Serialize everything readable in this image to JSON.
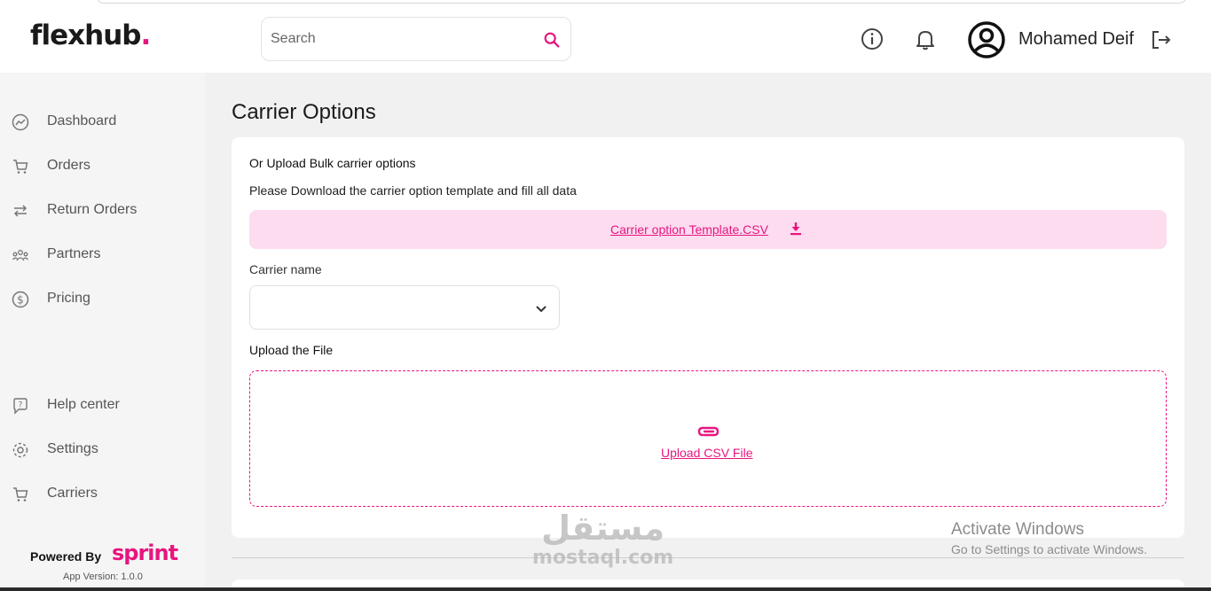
{
  "header": {
    "logo_text": "flexhub",
    "logo_dot": ".",
    "search_placeholder": "Search",
    "user_name": "Mohamed Deif"
  },
  "sidebar": {
    "items": [
      {
        "label": "Dashboard",
        "icon": "dashboard-icon"
      },
      {
        "label": "Orders",
        "icon": "cart-icon"
      },
      {
        "label": "Return Orders",
        "icon": "return-icon"
      },
      {
        "label": "Partners",
        "icon": "partners-icon"
      },
      {
        "label": "Pricing",
        "icon": "dollar-icon"
      }
    ],
    "bottom_items": [
      {
        "label": "Help center",
        "icon": "help-icon"
      },
      {
        "label": "Settings",
        "icon": "gear-icon"
      },
      {
        "label": "Carriers",
        "icon": "cart-icon"
      }
    ],
    "powered_by": "Powered By",
    "brand": "sprint",
    "app_version": "App Version: 1.0.0"
  },
  "main": {
    "page_title": "Carrier Options",
    "card": {
      "heading": "Or Upload Bulk carrier options",
      "description": "Please Download the carrier option template and fill all data",
      "template_link": "Carrier option Template.CSV",
      "carrier_label": "Carrier name",
      "carrier_value": "",
      "upload_label": "Upload the File",
      "upload_link": "Upload CSV File"
    }
  },
  "overlay": {
    "activate_title": "Activate Windows",
    "activate_sub": "Go to Settings to activate Windows.",
    "watermark_ar": "مستقل",
    "watermark_en": "mostaql.com"
  },
  "colors": {
    "accent": "#e8157f",
    "accent_light": "#fddcf0"
  }
}
